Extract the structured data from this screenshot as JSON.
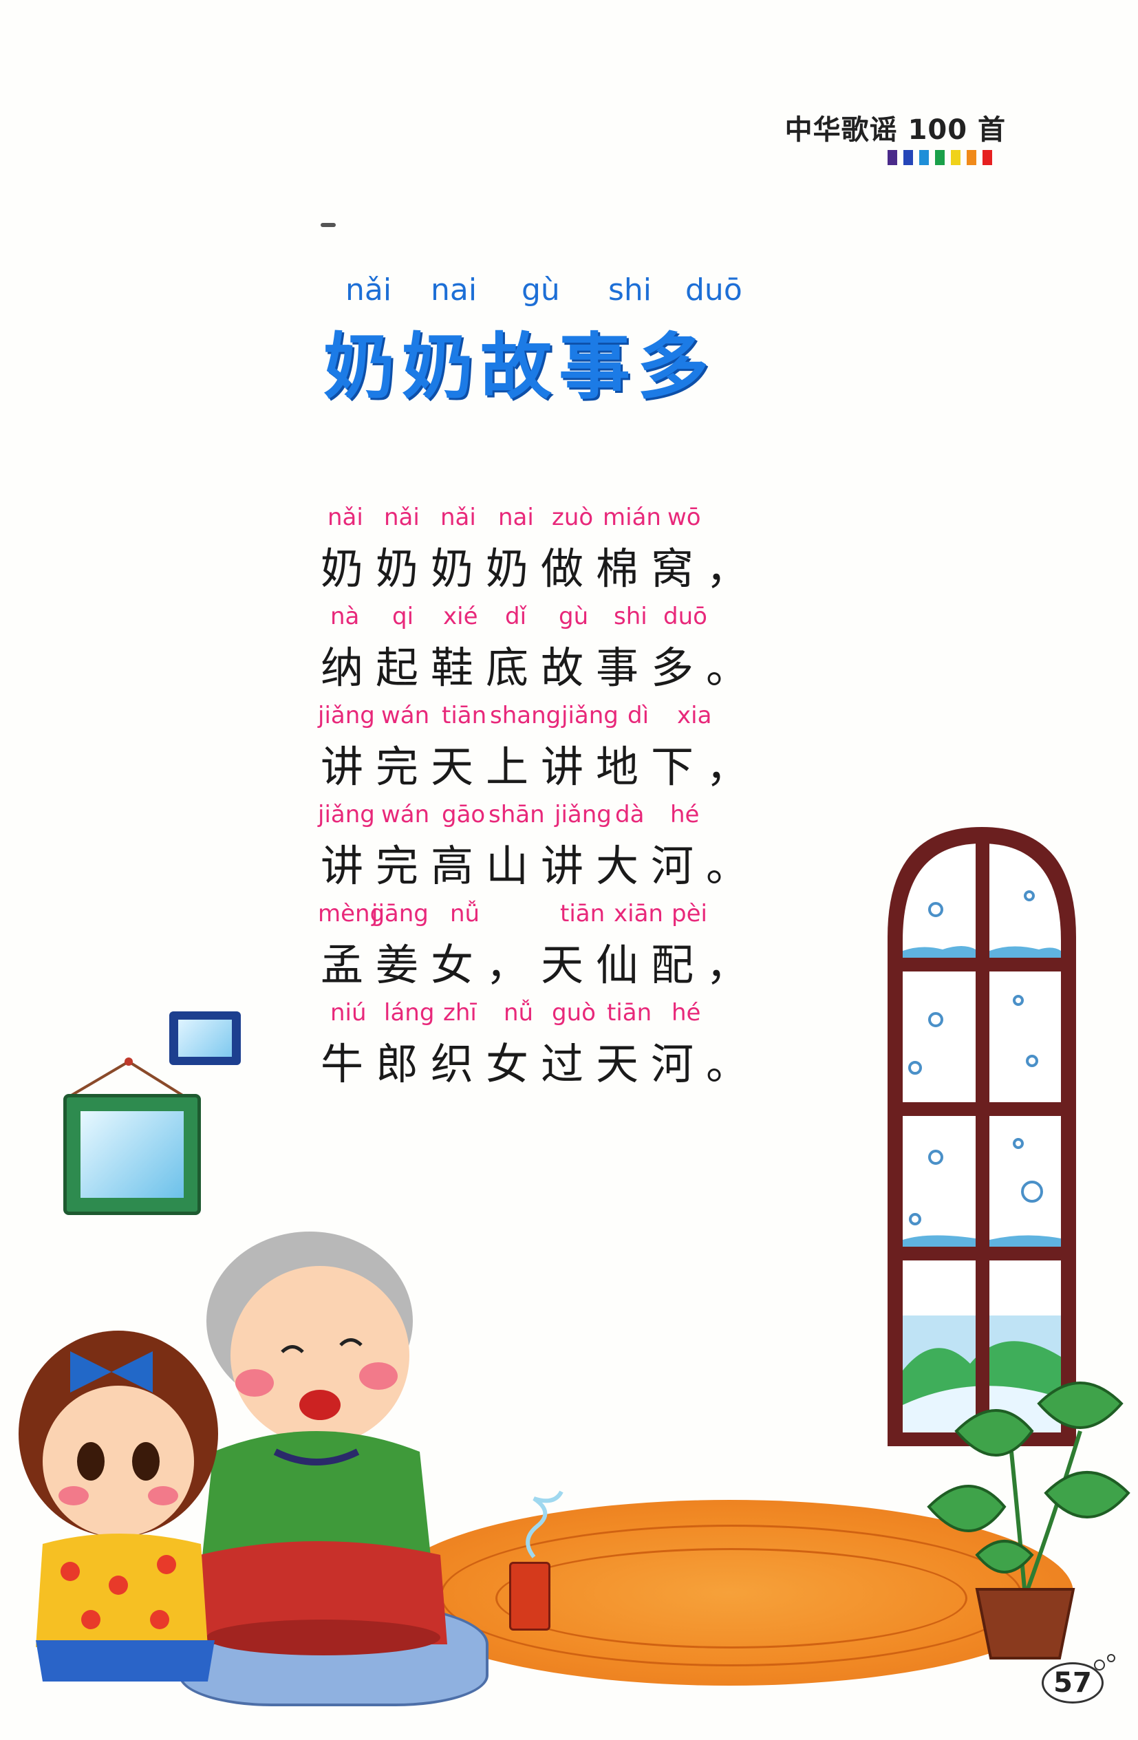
{
  "header": {
    "series_title": "中华歌谣 100 首",
    "color_bar": [
      "#4a2a8a",
      "#2546b8",
      "#1f8fd8",
      "#1aa04a",
      "#f0d21a",
      "#f08a1a",
      "#e62020"
    ]
  },
  "title": {
    "pinyin": [
      "nǎi",
      "nai",
      "gù",
      "shi",
      "duō"
    ],
    "text": "奶奶故事多"
  },
  "poem": {
    "lines": [
      {
        "pinyin": [
          "nǎi",
          "nǎi",
          "nǎi",
          "nai",
          "zuò",
          "mián",
          "wō"
        ],
        "text": "奶奶奶奶做棉窝，"
      },
      {
        "pinyin": [
          "nà",
          "qi",
          "xié",
          "dǐ",
          "gù",
          "shi",
          "duō"
        ],
        "text": "纳起鞋底故事多。"
      },
      {
        "pinyin": [
          "jiǎng",
          "wán",
          "tiān",
          "shang",
          "jiǎng",
          "dì",
          "xia"
        ],
        "text": "讲完天上讲地下，"
      },
      {
        "pinyin": [
          "jiǎng",
          "wán",
          "gāo",
          "shān",
          "jiǎng",
          "dà",
          "hé"
        ],
        "text": "讲完高山讲大河。"
      },
      {
        "pinyin": [
          "mèng",
          "jiāng",
          "nǚ",
          "tiān",
          "xiān",
          "pèi"
        ],
        "text": "孟姜女，天仙配，"
      },
      {
        "pinyin": [
          "niú",
          "láng",
          "zhī",
          "nǚ",
          "guò",
          "tiān",
          "hé"
        ],
        "text": "牛郎织女过天河。"
      }
    ]
  },
  "footer": {
    "page_number": "57"
  }
}
